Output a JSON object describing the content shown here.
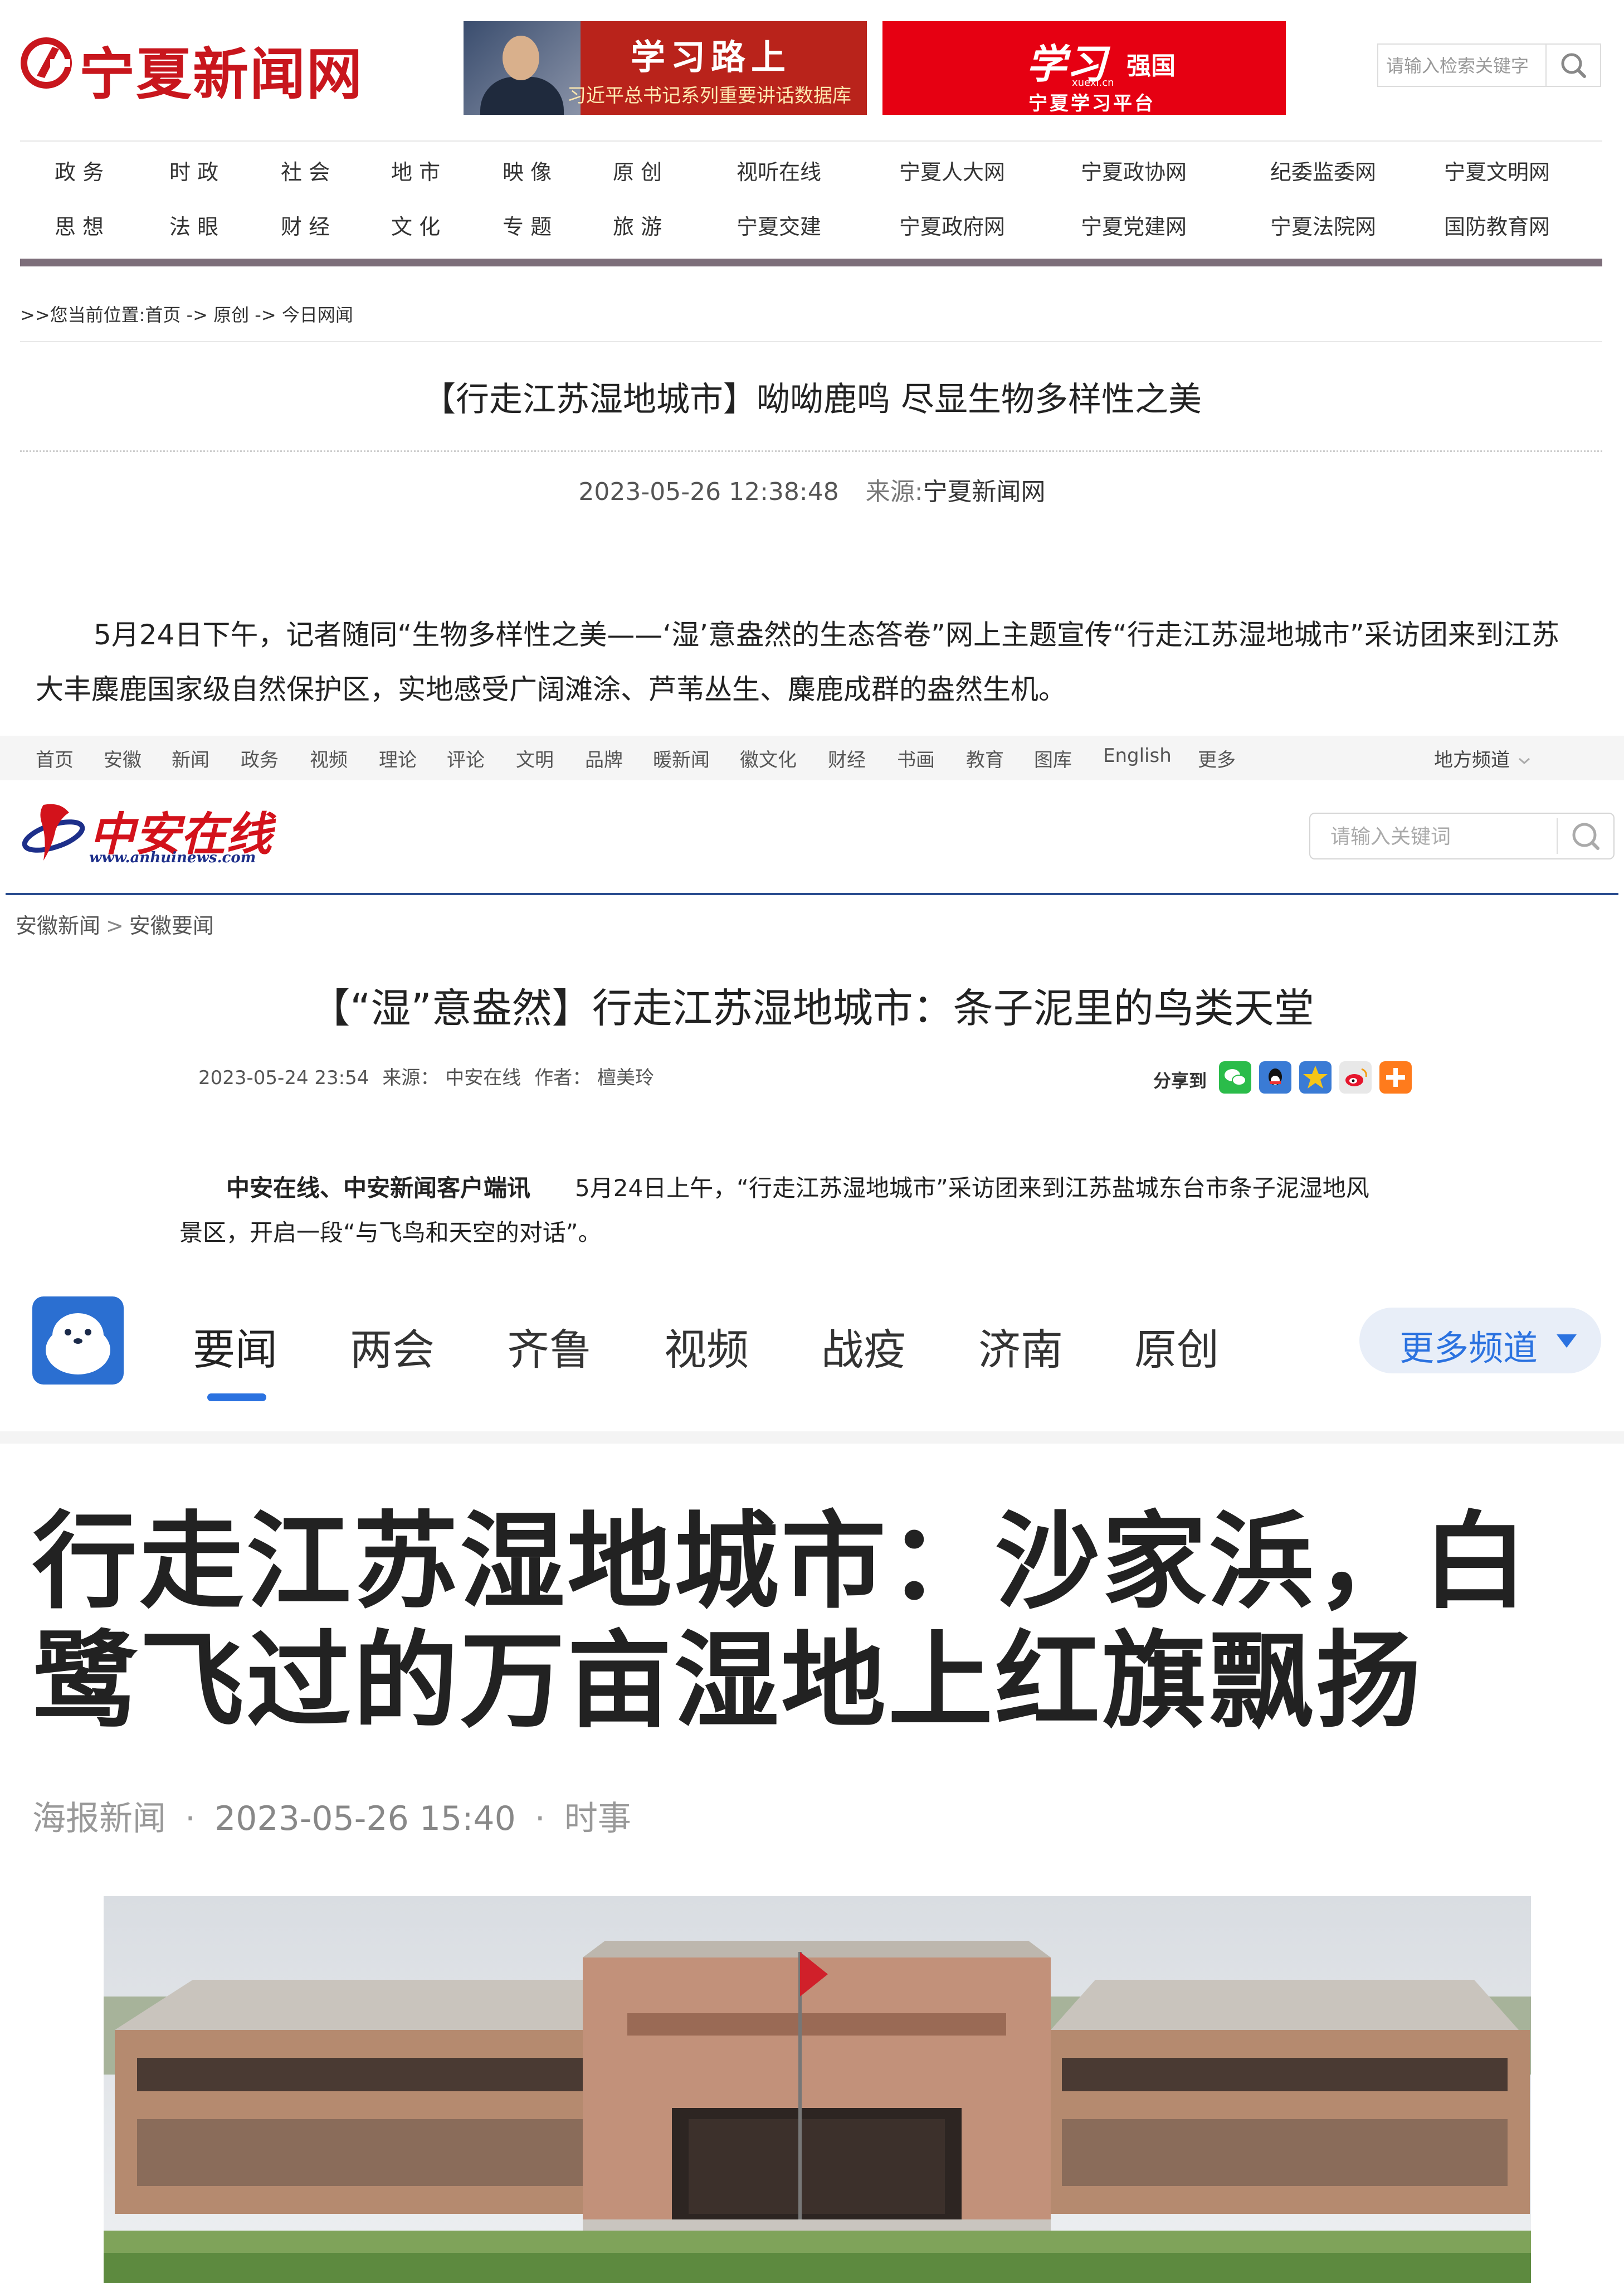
{
  "ningxia": {
    "logo_text": "宁夏新闻网",
    "banner_study_road": {
      "title": "学习路上",
      "subtitle": "习近平总书记系列重要讲话数据库"
    },
    "banner_xuexi": {
      "title": "学习",
      "title_suffix": "强国",
      "domain": "xuexi.cn",
      "subtitle": "宁夏学习平台"
    },
    "search_placeholder": "请输入检索关键字",
    "nav_row1": [
      "政 务",
      "时 政",
      "社 会",
      "地 市",
      "映 像",
      "原 创",
      "视听在线",
      "宁夏人大网",
      "宁夏政协网",
      "纪委监委网",
      "宁夏文明网"
    ],
    "nav_row2": [
      "思 想",
      "法 眼",
      "财 经",
      "文 化",
      "专 题",
      "旅 游",
      "宁夏交建",
      "宁夏政府网",
      "宁夏党建网",
      "宁夏法院网",
      "国防教育网"
    ],
    "breadcrumb": ">>您当前位置:首页 -> 原创 -> 今日网闻",
    "article_title": "【行走江苏湿地城市】呦呦鹿鸣 尽显生物多样性之美",
    "datetime": "2023-05-26 12:38:48",
    "source_label": "来源:",
    "source_value": "宁夏新闻网",
    "paragraph": "5月24日下午，记者随同“生物多样性之美——‘湿’意盎然的生态答卷”网上主题宣传“行走江苏湿地城市”采访团来到江苏大丰麋鹿国家级自然保护区，实地感受广阔滩涂、芦苇丛生、麋鹿成群的盎然生机。"
  },
  "anhui": {
    "nav": [
      "首页",
      "安徽",
      "新闻",
      "政务",
      "视频",
      "理论",
      "评论",
      "文明",
      "品牌",
      "暖新闻",
      "徽文化",
      "财经",
      "书画",
      "教育",
      "图库",
      "English",
      "更多"
    ],
    "local_channel": "地方频道",
    "logo_text": "中安在线",
    "logo_url": "www.anhuinews.com",
    "search_placeholder": "请输入关键词",
    "breadcrumb_1": "安徽新闻",
    "breadcrumb_sep": ">",
    "breadcrumb_2": "安徽要闻",
    "article_title": "【“湿”意盎然】行走江苏湿地城市：条子泥里的鸟类天堂",
    "datetime": "2023-05-24 23:54",
    "source": "来源： 中安在线",
    "author": "作者： 檀美玲",
    "share_label": "分享到",
    "share_colors": [
      "#2bbc4a",
      "#3a7bd5",
      "#f5a623",
      "#e8e8e8",
      "#ff7b1c"
    ],
    "para_lead": "中安在线、中安新闻客户端讯",
    "para_line1": "5月24日上午，“行走江苏湿地城市”采访团来到江苏盐城东台市条子泥湿地风",
    "para_line2": "景区，开启一段“与飞鸟和天空的对话”。"
  },
  "haibao": {
    "tabs": [
      "要闻",
      "两会",
      "齐鲁",
      "视频",
      "战疫",
      "济南",
      "原创"
    ],
    "active_tab": "要闻",
    "more_label": "更多频道",
    "title": "行走江苏湿地城市：沙家浜，白鹭飞过的万亩湿地上红旗飘扬",
    "source": "海报新闻",
    "datetime": "2023-05-26 15:40",
    "category": "时事",
    "dot": "·"
  },
  "colors": {
    "ningxia_red": "#c8161d",
    "anhui_blue": "#2a4d8f",
    "haibao_blue": "#2b72e0"
  }
}
